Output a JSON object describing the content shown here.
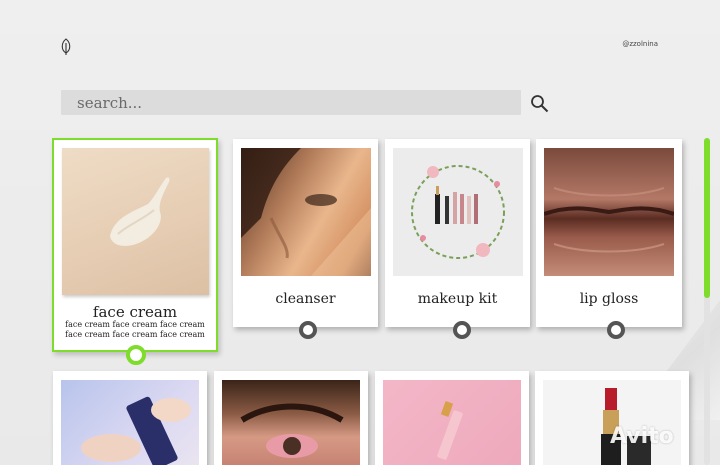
{
  "header": {
    "handle": "@zzolnina",
    "logo_icon": "leaf-icon"
  },
  "search": {
    "placeholder": "search...",
    "value": "",
    "icon": "search-icon"
  },
  "colors": {
    "accent": "#7edc2b",
    "radio": "#555555",
    "search_bg": "#dcdcdc"
  },
  "cards": [
    {
      "title": "face cream",
      "description": "face cream face cream face cream face cream face cream face cream",
      "selected": true
    },
    {
      "title": "cleanser",
      "selected": false
    },
    {
      "title": "makeup kit",
      "selected": false
    },
    {
      "title": "lip gloss",
      "selected": false
    }
  ],
  "watermark": "Avito"
}
